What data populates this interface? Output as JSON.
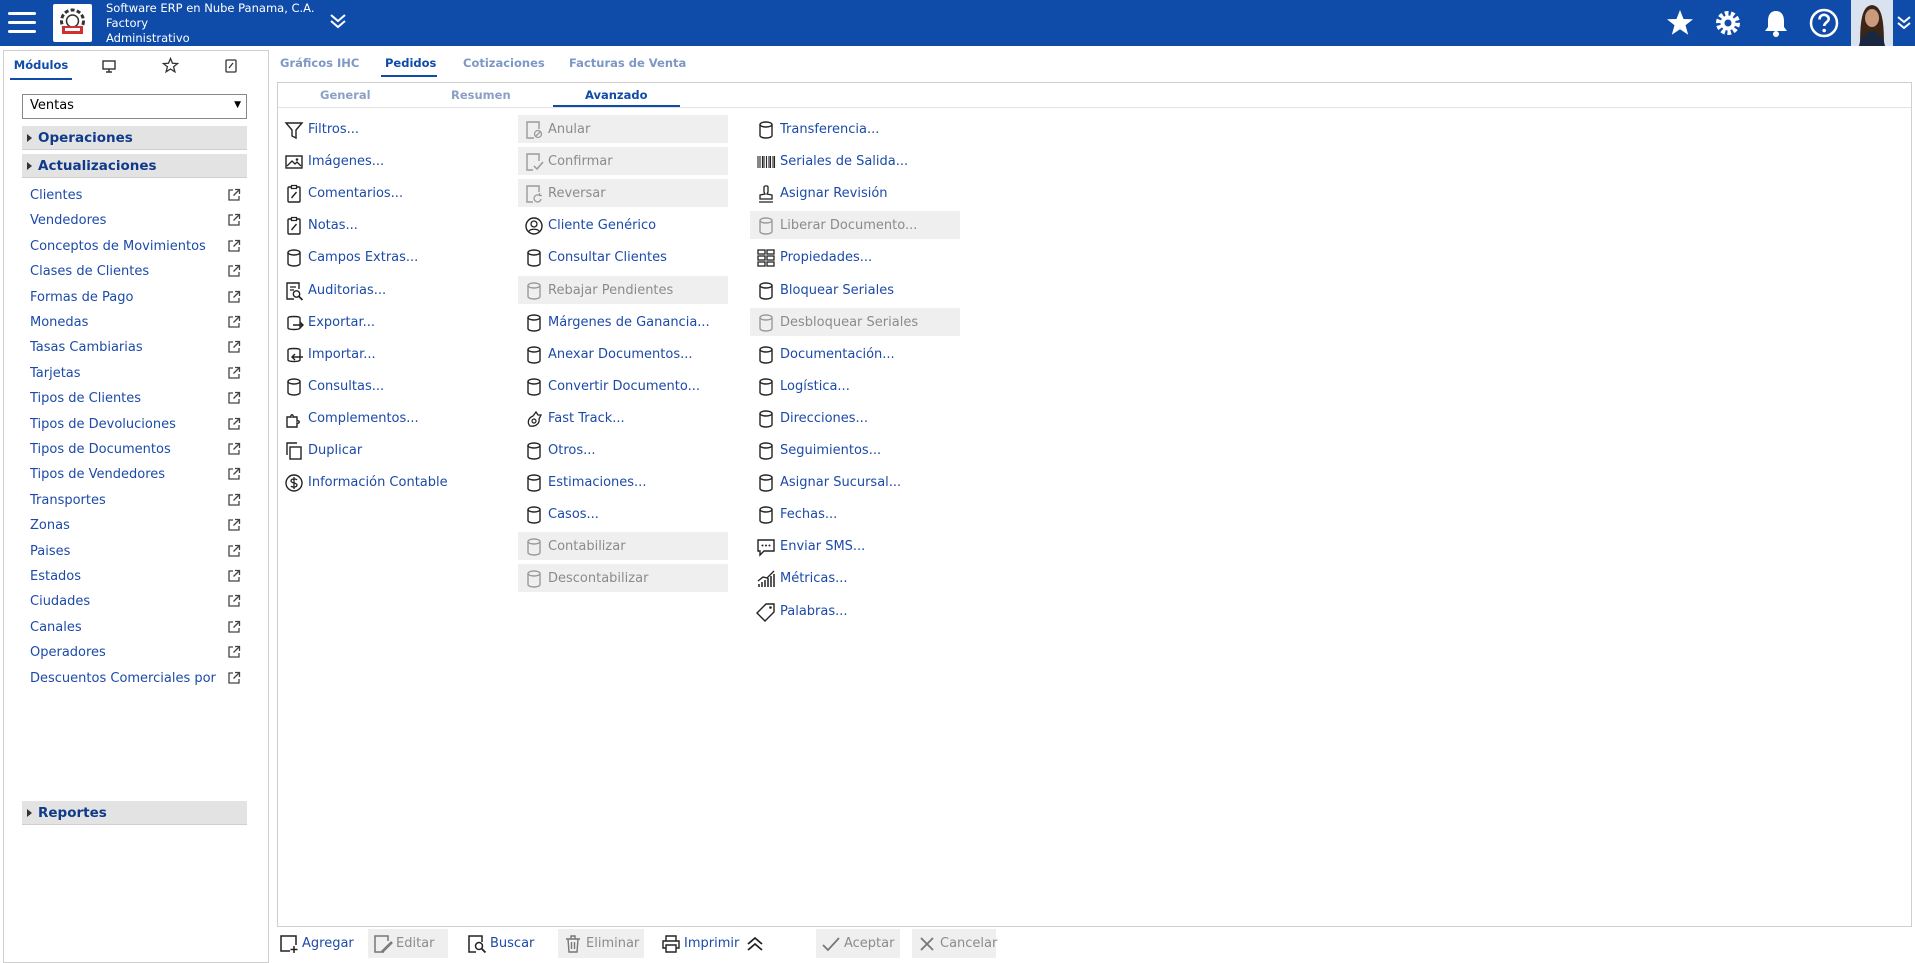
{
  "header": {
    "company_line1": "Software ERP en Nube Panama, C.A.",
    "company_line2": "Factory",
    "company_line3": "Administrativo"
  },
  "left_tabs": {
    "modulos": "Módulos"
  },
  "module_select": {
    "value": "Ventas"
  },
  "groups": {
    "operaciones": "Operaciones",
    "actualizaciones": "Actualizaciones",
    "reportes": "Reportes"
  },
  "sidebar_items": [
    "Clientes",
    "Vendedores",
    "Conceptos de Movimientos",
    "Clases de Clientes",
    "Formas de Pago",
    "Monedas",
    "Tasas Cambiarias",
    "Tarjetas",
    "Tipos de Clientes",
    "Tipos de Devoluciones",
    "Tipos de Documentos",
    "Tipos de Vendedores",
    "Transportes",
    "Zonas",
    "Paises",
    "Estados",
    "Ciudades",
    "Canales",
    "Operadores",
    "Descuentos Comerciales por Volumen"
  ],
  "main_tabs": [
    "Gráficos IHC",
    "Pedidos",
    "Cotizaciones",
    "Facturas de Venta"
  ],
  "sub_tabs": [
    "General",
    "Resumen",
    "Avanzado"
  ],
  "column1": [
    {
      "label": "Filtros...",
      "icon": "filter-icon"
    },
    {
      "label": "Imágenes...",
      "icon": "image-icon"
    },
    {
      "label": "Comentarios...",
      "icon": "clipboard-icon"
    },
    {
      "label": "Notas...",
      "icon": "clipboard-icon"
    },
    {
      "label": "Campos Extras...",
      "icon": "database-icon"
    },
    {
      "label": "Auditorias...",
      "icon": "audit-icon"
    },
    {
      "label": "Exportar...",
      "icon": "export-icon"
    },
    {
      "label": "Importar...",
      "icon": "import-icon"
    },
    {
      "label": "Consultas...",
      "icon": "database-icon"
    },
    {
      "label": "Complementos...",
      "icon": "puzzle-icon"
    },
    {
      "label": "Duplicar",
      "icon": "copy-icon"
    },
    {
      "label": "Información Contable",
      "icon": "dollar-icon"
    }
  ],
  "column2": [
    {
      "label": "Anular",
      "icon": "cancel-doc-icon",
      "disabled": true
    },
    {
      "label": "Confirmar",
      "icon": "confirm-doc-icon",
      "disabled": true
    },
    {
      "label": "Reversar",
      "icon": "reverse-doc-icon",
      "disabled": true
    },
    {
      "label": "Cliente Genérico",
      "icon": "user-icon"
    },
    {
      "label": "Consultar Clientes",
      "icon": "database-icon"
    },
    {
      "label": "Rebajar Pendientes",
      "icon": "database-icon",
      "disabled": true
    },
    {
      "label": "Márgenes de Ganancia...",
      "icon": "database-icon"
    },
    {
      "label": "Anexar Documentos...",
      "icon": "database-icon"
    },
    {
      "label": "Convertir Documento...",
      "icon": "database-icon"
    },
    {
      "label": "Fast Track...",
      "icon": "fast-track-icon"
    },
    {
      "label": "Otros...",
      "icon": "database-icon"
    },
    {
      "label": "Estimaciones...",
      "icon": "database-icon"
    },
    {
      "label": "Casos...",
      "icon": "database-icon"
    },
    {
      "label": "Contabilizar",
      "icon": "database-icon",
      "disabled": true
    },
    {
      "label": "Descontabilizar",
      "icon": "database-icon",
      "disabled": true
    }
  ],
  "column3": [
    {
      "label": "Transferencia...",
      "icon": "database-icon"
    },
    {
      "label": "Seriales de Salida...",
      "icon": "barcode-icon"
    },
    {
      "label": "Asignar Revisión",
      "icon": "stamp-icon"
    },
    {
      "label": "Liberar Documento...",
      "icon": "database-icon",
      "disabled": true
    },
    {
      "label": "Propiedades...",
      "icon": "properties-icon"
    },
    {
      "label": "Bloquear Seriales",
      "icon": "database-icon"
    },
    {
      "label": "Desbloquear Seriales",
      "icon": "database-icon",
      "disabled": true
    },
    {
      "label": "Documentación...",
      "icon": "database-icon"
    },
    {
      "label": "Logística...",
      "icon": "database-icon"
    },
    {
      "label": "Direcciones...",
      "icon": "database-icon"
    },
    {
      "label": "Seguimientos...",
      "icon": "database-icon"
    },
    {
      "label": "Asignar Sucursal...",
      "icon": "database-icon"
    },
    {
      "label": "Fechas...",
      "icon": "database-icon"
    },
    {
      "label": "Enviar SMS...",
      "icon": "sms-icon"
    },
    {
      "label": "Métricas...",
      "icon": "metrics-icon"
    },
    {
      "label": "Palabras...",
      "icon": "tag-icon"
    }
  ],
  "bottom": {
    "agregar": "Agregar",
    "editar": "Editar",
    "buscar": "Buscar",
    "eliminar": "Eliminar",
    "imprimir": "Imprimir",
    "aceptar": "Aceptar",
    "cancelar": "Cancelar"
  },
  "colors": {
    "brand": "#0f4ba9",
    "link": "#1c4aa8",
    "disabled_bg": "#efefef",
    "disabled_text": "#8b8b8b"
  }
}
